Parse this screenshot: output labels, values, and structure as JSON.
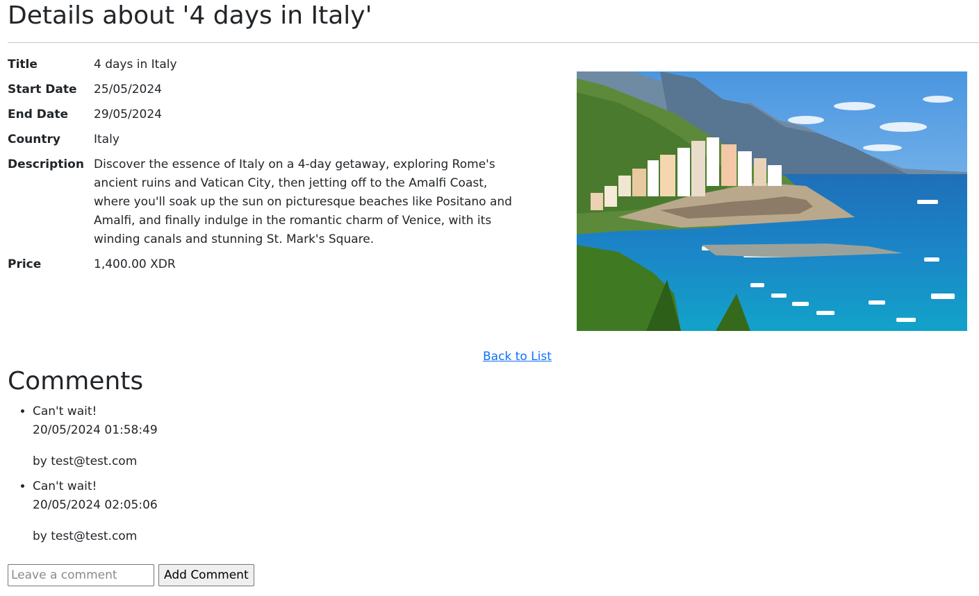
{
  "page": {
    "title": "Details about '4 days in Italy'"
  },
  "details": {
    "fields": [
      {
        "label": "Title",
        "value": "4 days in Italy"
      },
      {
        "label": "Start Date",
        "value": "25/05/2024"
      },
      {
        "label": "End Date",
        "value": "29/05/2024"
      },
      {
        "label": "Country",
        "value": "Italy"
      },
      {
        "label": "Description",
        "value": "Discover the essence of Italy on a 4-day getaway, exploring Rome's ancient ruins and Vatican City, then jetting off to the Amalfi Coast, where you'll soak up the sun on picturesque beaches like Positano and Amalfi, and finally indulge in the romantic charm of Venice, with its winding canals and stunning St. Mark's Square."
      },
      {
        "label": "Price",
        "value": "1,400.00 XDR"
      }
    ]
  },
  "links": {
    "back": "Back to List"
  },
  "comments": {
    "heading": "Comments",
    "items": [
      {
        "text": "Can't wait!",
        "date": "20/05/2024 01:58:49",
        "author": "by test@test.com"
      },
      {
        "text": "Can't wait!",
        "date": "20/05/2024 02:05:06",
        "author": "by test@test.com"
      }
    ],
    "input_placeholder": "Leave a comment",
    "input_value": "",
    "add_button": "Add Comment"
  },
  "colors": {
    "link": "#0d6efd",
    "text": "#212529",
    "sea": "#1a7fc4",
    "sky": "#6fb0ea"
  }
}
